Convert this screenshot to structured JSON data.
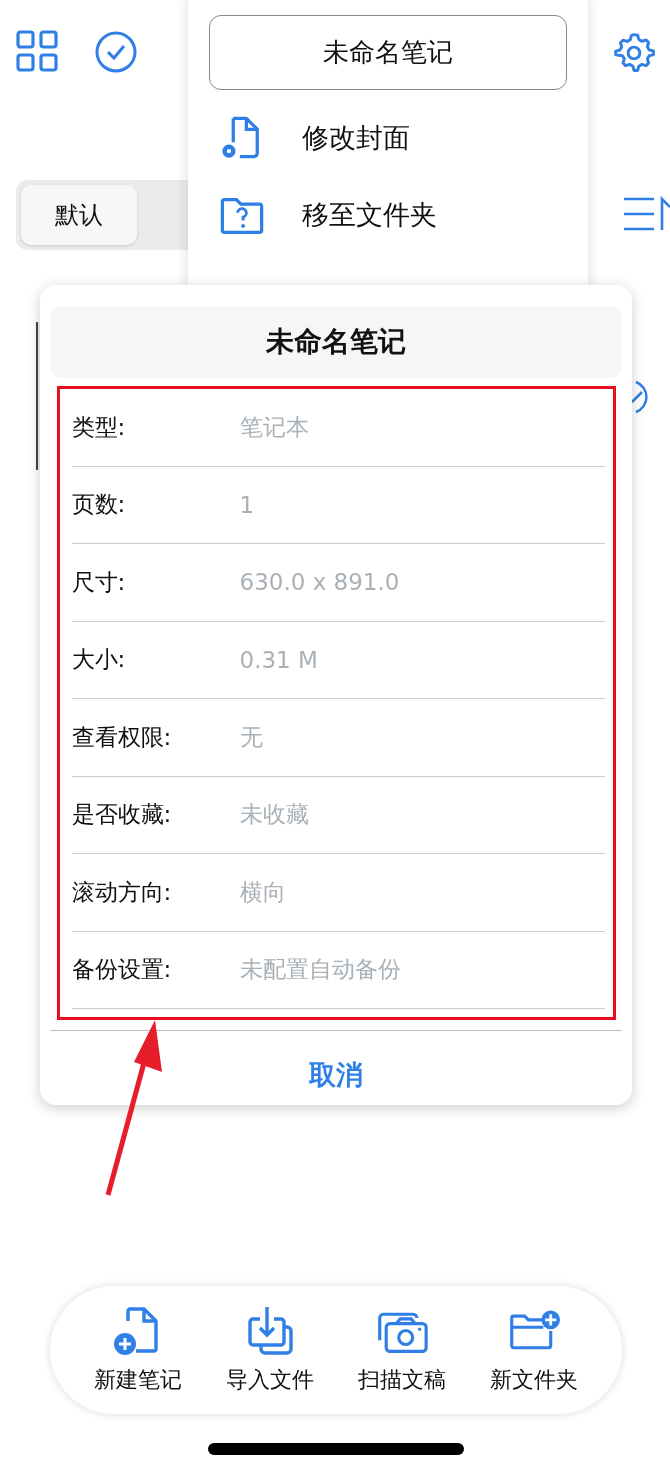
{
  "segmented_control": [
    {
      "label": "默认",
      "selected": true
    }
  ],
  "menu": {
    "name_field": {
      "value": "未命名笔记"
    },
    "items": [
      {
        "kind": "cover",
        "label": "修改封面"
      },
      {
        "kind": "folder",
        "label": "移至文件夹"
      }
    ]
  },
  "info_dialog": {
    "title": "未命名笔记",
    "rows": [
      {
        "label": "类型:",
        "value": "笔记本"
      },
      {
        "label": "页数:",
        "value": "1"
      },
      {
        "label": "尺寸:",
        "value": "630.0 x 891.0"
      },
      {
        "label": "大小:",
        "value": "0.31 M"
      },
      {
        "label": "查看权限:",
        "value": "无"
      },
      {
        "label": "是否收藏:",
        "value": "未收藏"
      },
      {
        "label": "滚动方向:",
        "value": "横向"
      },
      {
        "label": "备份设置:",
        "value": "未配置自动备份"
      }
    ],
    "cancel": "取消"
  },
  "toolbar": [
    {
      "kind": "new-note",
      "label": "新建笔记"
    },
    {
      "kind": "import",
      "label": "导入文件"
    },
    {
      "kind": "scan",
      "label": "扫描文稿"
    },
    {
      "kind": "new-folder",
      "label": "新文件夹"
    }
  ]
}
